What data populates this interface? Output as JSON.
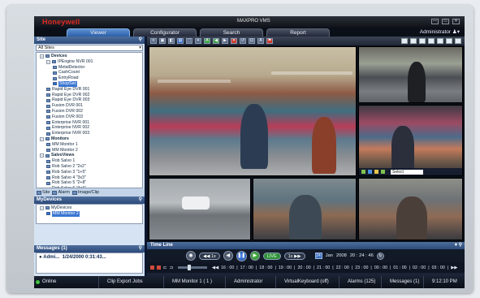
{
  "window": {
    "brand": "Honeywell",
    "product": "MAXPRO VMS",
    "controls": [
      "—",
      "▭",
      "✕"
    ]
  },
  "nav": {
    "tabs": [
      "Viewer",
      "Configurator",
      "Search",
      "Report"
    ],
    "active_tab": "Viewer",
    "user": "Administrator"
  },
  "site_panel": {
    "title": "Site",
    "filter": "All Sites",
    "tree": [
      {
        "label": "Devices",
        "level": 1,
        "expand": "−",
        "bold": true
      },
      {
        "label": "IPEngine NVR 001",
        "level": 2,
        "expand": "−"
      },
      {
        "label": "MetalDetector",
        "level": 3
      },
      {
        "label": "CashCount",
        "level": 3
      },
      {
        "label": "EntryRoad",
        "level": 3
      },
      {
        "label": "ShopSec",
        "level": 3,
        "highlight": true
      },
      {
        "label": "Rapid Eye DVR 001",
        "level": 2
      },
      {
        "label": "Rapid Eye DVR 002",
        "level": 2
      },
      {
        "label": "Rapid Eye DVR 003",
        "level": 2
      },
      {
        "label": "Fusion DVR 001",
        "level": 2
      },
      {
        "label": "Fusion DVR 002",
        "level": 2
      },
      {
        "label": "Fusion DVR 003",
        "level": 2
      },
      {
        "label": "Enterprise NVR 001",
        "level": 2
      },
      {
        "label": "Enterprise NVR 002",
        "level": 2
      },
      {
        "label": "Enterprise NVR 003",
        "level": 2
      },
      {
        "label": "Monitors",
        "level": 1,
        "expand": "−",
        "bold": true
      },
      {
        "label": "MM Monitor 1",
        "level": 2
      },
      {
        "label": "MM Monitor 2",
        "level": 2
      },
      {
        "label": "SalvoViews",
        "level": 1,
        "expand": "−",
        "bold": true
      },
      {
        "label": "Rob Salvo 1",
        "level": 2
      },
      {
        "label": "Rob Salvo 2 \"2x2\"",
        "level": 2
      },
      {
        "label": "Rob Salvo 3 \"1+5\"",
        "level": 2
      },
      {
        "label": "Rob Salvo 4 \"3x3\"",
        "level": 2
      },
      {
        "label": "Rob Salvo 5 \"2+8\"",
        "level": 2
      },
      {
        "label": "Rob Salvo 6 \"4x4\"",
        "level": 2
      }
    ],
    "tabs": [
      "Site",
      "Alarm",
      "Image/Clip"
    ]
  },
  "my_devices": {
    "title": "MyDevices",
    "items": [
      {
        "label": "MyDevices",
        "level": 1,
        "expand": "−"
      },
      {
        "label": "MM Monitor 2",
        "level": 2,
        "highlight": true
      }
    ]
  },
  "messages": {
    "title": "Messages (1)",
    "row_user": "Admi...",
    "row_time": "1/24/2000 0:31:43..."
  },
  "toolbar": {
    "buttons": [
      "≡",
      "▣",
      "◧",
      "▤",
      "⬚",
      "✈",
      "A",
      "◀",
      "▶",
      "✕",
      "↺",
      "⊡",
      "A",
      "⚑"
    ]
  },
  "camera": {
    "select": "Select"
  },
  "timeline": {
    "title": "Time Line",
    "live_label": "LIVE",
    "speed_label": "1x",
    "date_month": "Jan",
    "date_year": "2008",
    "date_time": "20 : 24 : 46",
    "ticks": [
      "16 : 00",
      "17 : 00",
      "18 : 00",
      "19 : 00",
      "20 : 00",
      "21 : 00",
      "22 : 00",
      "23 : 00",
      "00 : 00",
      "01 : 00",
      "02 : 00",
      "03 : 00"
    ]
  },
  "statusbar": {
    "online": "Online",
    "clip_export": "Clip Export Jobs",
    "monitor": "MM Monitor 1 ( 1 )",
    "user": "Administrator",
    "keyboard": "VirtualKeyboard (off)",
    "alarms": "Alarms (125)",
    "messages": "Messages (1)",
    "time": "9:12:10 PM"
  },
  "colors": {
    "brand_red": "#e02a22",
    "active_tab": "#2c5fa8",
    "panel_blue": "#2c4a7a"
  }
}
